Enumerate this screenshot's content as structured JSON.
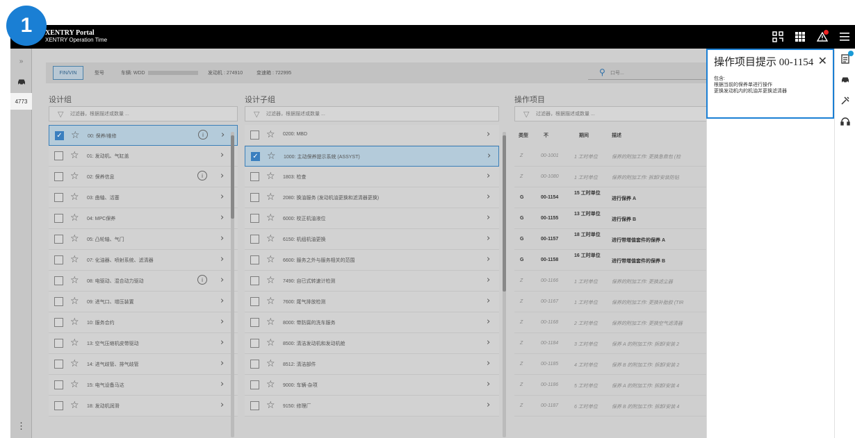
{
  "step_badge": "1",
  "header": {
    "title": "XENTRY Portal",
    "subtitle": "XENTRY Operation Time"
  },
  "left_rail": {
    "expand_icon": "»",
    "active_label": "4773"
  },
  "vehicle_bar": {
    "finvin_label": "FIN/VIN",
    "model_label": "型号",
    "vehicle_label": "车辆: WDD",
    "engine_label": "发动机 : 274910",
    "transmission_label": "变速箱 : 722995"
  },
  "search": {
    "placeholder": "口号..."
  },
  "design_groups": {
    "title": "设计组",
    "filter_placeholder": "过滤器，根据描述或数量 ...",
    "items": [
      {
        "label": "00: 保养/维修",
        "checked": true,
        "info": true
      },
      {
        "label": "01: 发动机、气缸盖",
        "checked": false,
        "info": false
      },
      {
        "label": "02: 保养信息",
        "checked": false,
        "info": true
      },
      {
        "label": "03: 曲轴、活塞",
        "checked": false,
        "info": false
      },
      {
        "label": "04: MPC保养",
        "checked": false,
        "info": false
      },
      {
        "label": "05: 凸轮轴、气门",
        "checked": false,
        "info": false
      },
      {
        "label": "07: 化油器、喷射系统、滤清器",
        "checked": false,
        "info": false
      },
      {
        "label": "08: 电驱动、混合动力驱动",
        "checked": false,
        "info": true
      },
      {
        "label": "09: 进气口、增压装置",
        "checked": false,
        "info": false
      },
      {
        "label": "10: 服务合约",
        "checked": false,
        "info": false
      },
      {
        "label": "13: 空气压缩机皮带驱动",
        "checked": false,
        "info": false
      },
      {
        "label": "14: 进气歧管、排气歧管",
        "checked": false,
        "info": false
      },
      {
        "label": "15: 电气设备马达",
        "checked": false,
        "info": false
      },
      {
        "label": "18: 发动机润滑",
        "checked": false,
        "info": false
      }
    ]
  },
  "design_subgroups": {
    "title": "设计子组",
    "filter_placeholder": "过滤器，根据描述或数量 ...",
    "items": [
      {
        "label": "0200: MBD",
        "checked": false
      },
      {
        "label": "1000: 主动保养提示系统 (ASSYST)",
        "checked": true
      },
      {
        "label": "1803: 检查",
        "checked": false
      },
      {
        "label": "2080: 换油服务 (发动机油更换和滤清器更换)",
        "checked": false
      },
      {
        "label": "6000: 校正机油液位",
        "checked": false
      },
      {
        "label": "6150: 机组机油更换",
        "checked": false
      },
      {
        "label": "6600: 服务之外与服务相关的范围",
        "checked": false
      },
      {
        "label": "7490: 自已式转速计检测",
        "checked": false
      },
      {
        "label": "7600: 尾气排放检测",
        "checked": false
      },
      {
        "label": "8000: 带防腐的洗车服务",
        "checked": false
      },
      {
        "label": "8500: 清洁发动机和发动机舱",
        "checked": false
      },
      {
        "label": "8512: 清洁部件",
        "checked": false
      },
      {
        "label": "9000: 车辆-杂项",
        "checked": false
      },
      {
        "label": "9150: 修理厂",
        "checked": false
      }
    ]
  },
  "operations": {
    "title": "操作项目",
    "filter_placeholder": "过滤器，根据描述或数量 ...",
    "headers": {
      "type": "类型",
      "no": "不",
      "period": "期间",
      "desc": "描述"
    },
    "rows": [
      {
        "type": "Z",
        "no": "00-1001",
        "period": "1 工时单位",
        "desc": "保养的附加工作: 更换急救包 (检",
        "style": "italic"
      },
      {
        "type": "Z",
        "no": "00-1080",
        "period": "1 工时单位",
        "desc": "保养的附加工作: 拆卸/安装防钻",
        "style": "italic"
      },
      {
        "type": "G",
        "no": "00-1154",
        "period": "15 工时单位",
        "desc": "进行保养 A",
        "style": "bold"
      },
      {
        "type": "G",
        "no": "00-1155",
        "period": "13 工时单位",
        "desc": "进行保养 B",
        "style": "bold"
      },
      {
        "type": "G",
        "no": "00-1157",
        "period": "18 工时单位",
        "desc": "进行带增值套件的保养 A",
        "style": "bold"
      },
      {
        "type": "G",
        "no": "00-1158",
        "period": "16 工时单位",
        "desc": "进行带增值套件的保养 B",
        "style": "bold"
      },
      {
        "type": "Z",
        "no": "00-1166",
        "period": "1 工时单位",
        "desc": "保养的附加工作: 更换滤尘器",
        "style": "italic"
      },
      {
        "type": "Z",
        "no": "00-1167",
        "period": "1 工时单位",
        "desc": "保养的附加工作: 更换补胎胶 (TIR",
        "style": "italic"
      },
      {
        "type": "Z",
        "no": "00-1168",
        "period": "2 工时单位",
        "desc": "保养的附加工作: 更换空气滤清器",
        "style": "italic"
      },
      {
        "type": "Z",
        "no": "00-1184",
        "period": "3 工时单位",
        "desc": "保养 A 的附加工作: 拆卸/安装 2",
        "style": "italic"
      },
      {
        "type": "Z",
        "no": "00-1185",
        "period": "4 工时单位",
        "desc": "保养 B 的附加工作: 拆卸/安装 2",
        "style": "italic"
      },
      {
        "type": "Z",
        "no": "00-1186",
        "period": "5 工时单位",
        "desc": "保养 A 的附加工作: 拆卸/安装 4",
        "style": "italic"
      },
      {
        "type": "Z",
        "no": "00-1187",
        "period": "6 工时单位",
        "desc": "保养 B 的附加工作: 拆卸/安装 4",
        "style": "italic"
      }
    ]
  },
  "hint_panel": {
    "title": "操作项目提示 00-1154",
    "close": "✕",
    "body_label": "包含:",
    "lines": [
      "根据当前的保养单进行操作",
      "更换发动机内的机油并更换滤清器"
    ]
  },
  "icons": {
    "top": [
      "qr-scan-icon",
      "grid-apps-icon",
      "warning-icon",
      "menu-icon"
    ],
    "right_rail": [
      "document-icon",
      "car-icon",
      "tools-icon",
      "headset-icon"
    ]
  }
}
